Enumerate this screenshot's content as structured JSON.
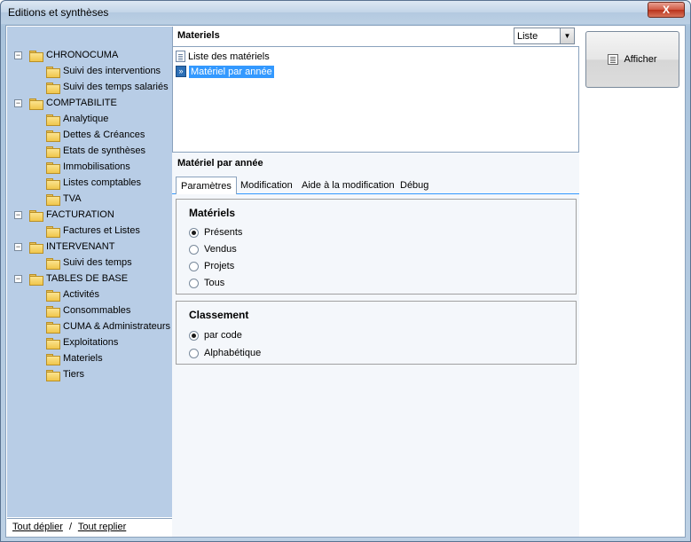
{
  "window": {
    "title": "Editions et synthèses",
    "close_label": "X"
  },
  "tree": [
    {
      "label": "CHRONOCUMA",
      "level": 0,
      "expander": "−"
    },
    {
      "label": "Suivi des interventions",
      "level": 1
    },
    {
      "label": "Suivi des temps salariés",
      "level": 1
    },
    {
      "label": "COMPTABILITE",
      "level": 0,
      "expander": "−"
    },
    {
      "label": "Analytique",
      "level": 1
    },
    {
      "label": "Dettes & Créances",
      "level": 1
    },
    {
      "label": "Etats de synthèses",
      "level": 1
    },
    {
      "label": "Immobilisations",
      "level": 1
    },
    {
      "label": "Listes comptables",
      "level": 1
    },
    {
      "label": "TVA",
      "level": 1
    },
    {
      "label": "FACTURATION",
      "level": 0,
      "expander": "−"
    },
    {
      "label": "Factures et Listes",
      "level": 1
    },
    {
      "label": "INTERVENANT",
      "level": 0,
      "expander": "−"
    },
    {
      "label": "Suivi des temps",
      "level": 1
    },
    {
      "label": "TABLES DE BASE",
      "level": 0,
      "expander": "−"
    },
    {
      "label": "Activités",
      "level": 1
    },
    {
      "label": "Consommables",
      "level": 1
    },
    {
      "label": "CUMA & Administrateurs",
      "level": 1
    },
    {
      "label": "Exploitations",
      "level": 1
    },
    {
      "label": "Materiels",
      "level": 1
    },
    {
      "label": "Tiers",
      "level": 1
    }
  ],
  "footer": {
    "expand_all": "Tout déplier",
    "separator": "/",
    "collapse_all": "Tout replier"
  },
  "list": {
    "title": "Materiels",
    "view_select": "Liste",
    "items": [
      {
        "label": "Liste des matériels",
        "selected": false
      },
      {
        "label": "Matériel par année",
        "selected": true
      }
    ]
  },
  "detail": {
    "title": "Matériel par année",
    "tabs": [
      "Paramètres",
      "Modification",
      "Aide à la modification",
      "Débug"
    ],
    "active_tab": "Paramètres"
  },
  "materiels_group": {
    "title": "Matériels",
    "options": [
      {
        "label": "Présents",
        "checked": true
      },
      {
        "label": "Vendus",
        "checked": false
      },
      {
        "label": "Projets",
        "checked": false
      },
      {
        "label": "Tous",
        "checked": false
      }
    ]
  },
  "classement_group": {
    "title": "Classement",
    "options": [
      {
        "label": "par code",
        "checked": true
      },
      {
        "label": "Alphabétique",
        "checked": false
      }
    ]
  },
  "actions": {
    "afficher_label": "Afficher"
  }
}
